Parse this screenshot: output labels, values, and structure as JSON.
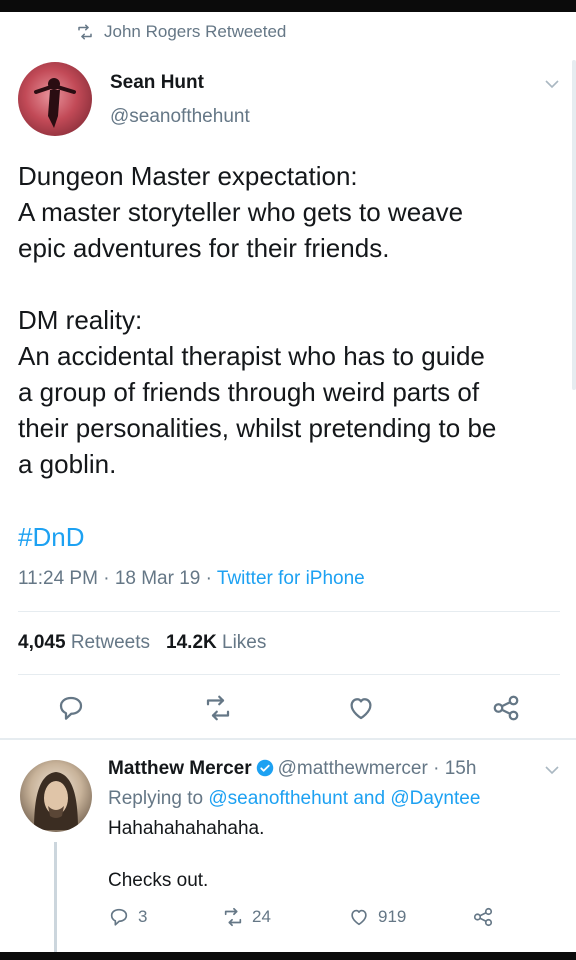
{
  "retweet_context": {
    "text": "John Rogers Retweeted"
  },
  "tweet": {
    "author_name": "Sean Hunt",
    "author_handle": "@seanofthehunt",
    "paragraph1": [
      "Dungeon Master expectation:",
      "A master storyteller who gets to weave",
      "epic adventures for their friends."
    ],
    "paragraph2": [
      "DM reality:",
      "An accidental therapist who has to guide",
      "a group of friends through weird parts of",
      "their personalities, whilst pretending to be",
      "a goblin."
    ],
    "hashtag": "#DnD",
    "time": "11:24 PM",
    "date": "18 Mar 19",
    "source": "Twitter for iPhone",
    "retweet_count": "4,045",
    "retweet_label": "Retweets",
    "like_count": "14.2K",
    "like_label": "Likes"
  },
  "reply": {
    "author_name": "Matthew Mercer",
    "author_handle": "@matthewmercer",
    "age": "15h",
    "replying_prefix": "Replying to",
    "replying_user1": "@seanofthehunt",
    "replying_and": "and",
    "replying_user2": "@Dayntee",
    "text1": "Hahahahahahaha.",
    "text2": "Checks out.",
    "reply_count": "3",
    "retweet_count": "24",
    "like_count": "919"
  },
  "icons": {
    "retweet": "retweet-icon",
    "reply": "reply-icon",
    "like": "heart-icon",
    "share": "share-icon",
    "verified": "verified-badge-icon",
    "menu": "chevron-down-icon"
  },
  "colors": {
    "link": "#1da1f2",
    "secondary_text": "#657786",
    "primary_text": "#14171a",
    "divider": "#e6ecf0"
  }
}
